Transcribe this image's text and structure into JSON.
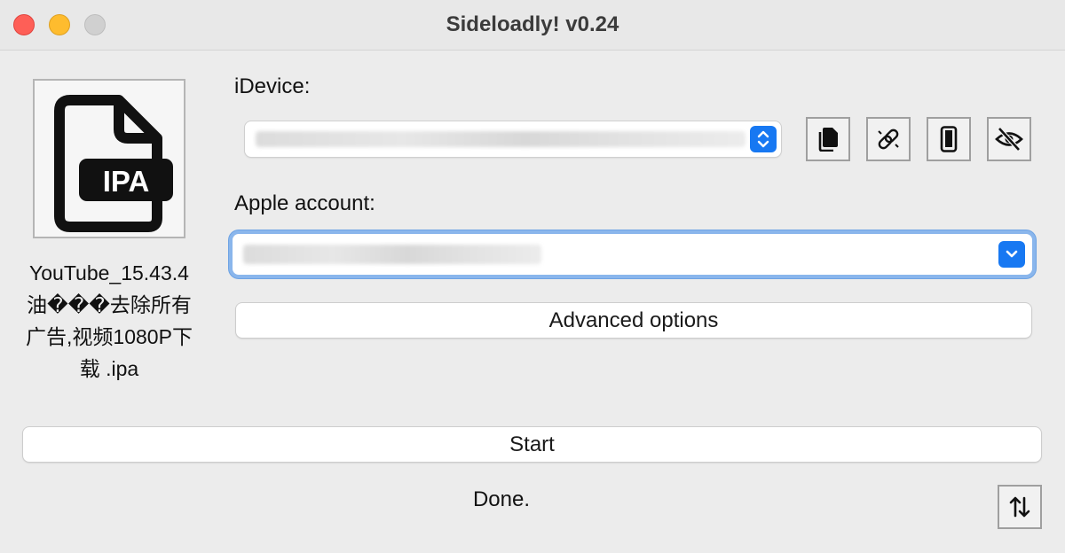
{
  "window": {
    "title": "Sideloadly! v0.24"
  },
  "app": {
    "ipa_badge": "IPA",
    "file_name": "YouTube_15.43.4油���去除所有广告,视频1080P下载 .ipa",
    "idevice_label": "iDevice:",
    "apple_account_label": "Apple account:",
    "advanced_options_label": "Advanced options",
    "start_label": "Start",
    "status_text": "Done."
  },
  "icons": {
    "copy": "copy-icon",
    "unlink": "unlink-icon",
    "device": "phone-icon",
    "hide": "eye-off-icon",
    "sort": "sort-arrows-icon"
  },
  "colors": {
    "accent": "#1778f2",
    "focus_ring": "#8ab6ec",
    "close": "#fe5f57",
    "minimize": "#febc2e"
  }
}
